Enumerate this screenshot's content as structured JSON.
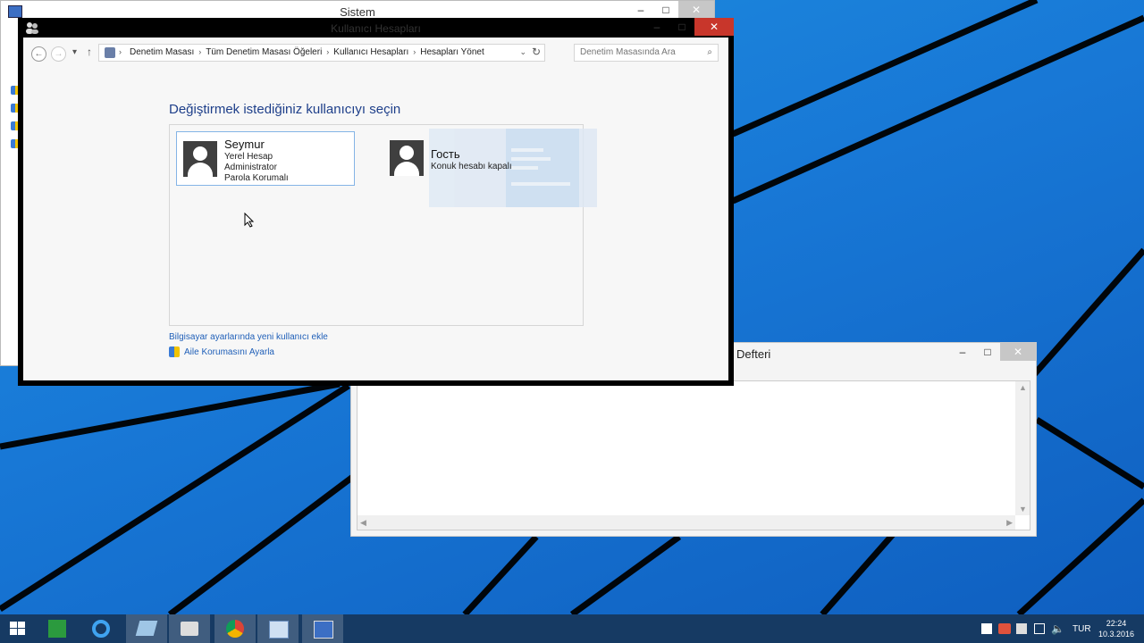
{
  "windows": {
    "sistem": {
      "title": "Sistem"
    },
    "main": {
      "title": "Kullanıcı Hesapları"
    },
    "notepad": {
      "title": "Defteri"
    }
  },
  "caption": {
    "minimize": "–",
    "maximize": "□",
    "close": "✕"
  },
  "navigation": {
    "back": "←",
    "forward": "→",
    "recent": "▾",
    "up": "↑",
    "breadcrumbs": [
      "Denetim Masası",
      "Tüm Denetim Masası Öğeleri",
      "Kullanıcı Hesapları",
      "Hesapları Yönet"
    ],
    "separator": "›",
    "dropdown": "⌄",
    "refresh": "↻"
  },
  "search": {
    "placeholder": "Denetim Masasında Ara",
    "icon": "⌕"
  },
  "page": {
    "heading": "Değiştirmek istediğiniz kullanıcıyı seçin",
    "accounts": [
      {
        "name": "Seymur",
        "lines": [
          "Yerel Hesap",
          "Administrator",
          "Parola Korumalı"
        ],
        "selected": true
      },
      {
        "name": "Гость",
        "lines": [
          "Konuk hesabı kapalı"
        ],
        "selected": false
      }
    ],
    "links": {
      "add_user": "Bilgisayar ayarlarında yeni kullanıcı ekle",
      "family_safety": "Aile Korumasını Ayarla"
    }
  },
  "taskbar": {
    "apps": [
      "start-button",
      "store",
      "internet-explorer",
      "file-explorer",
      "camera",
      "chrome",
      "control-panel",
      "system"
    ],
    "tray": {
      "language": "TUR",
      "time": "22:24",
      "date": "10.3.2016"
    }
  },
  "colors": {
    "accent_link": "#1f5fb8",
    "heading": "#1e3f8a",
    "close_button": "#c8362b",
    "taskbar": "#163a63",
    "desktop": "#1878d6"
  }
}
